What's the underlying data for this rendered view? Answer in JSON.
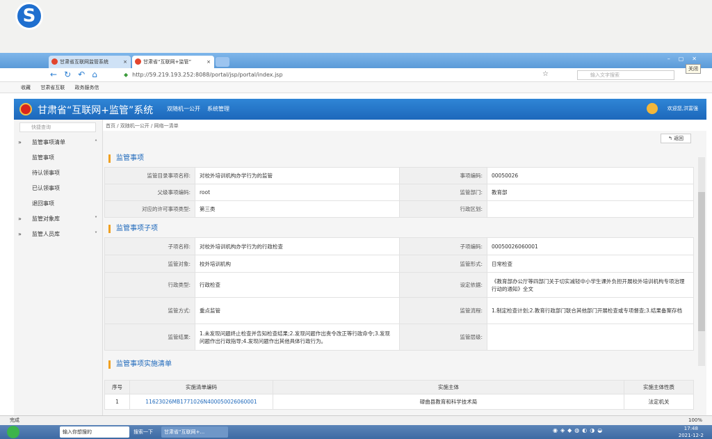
{
  "browser": {
    "tab1": "甘肃省互联网监管系统",
    "tab2": "甘肃省“互联网+监管”",
    "url": "http://59.219.193.252:8088/portal/jsp/portal/index.jsp",
    "search_placeholder": "输入文字搜索",
    "close_tooltip": "关闭",
    "bookmarks": [
      "收藏",
      "甘肃省互联",
      "政务服务信"
    ]
  },
  "app": {
    "title": "甘肃省“互联网+监管”系统",
    "menu": [
      "双随机一公开",
      "系统管理"
    ],
    "welcome": "欢迎您,洪富强"
  },
  "sidebar": {
    "search_placeholder": "快捷查询",
    "group1": "监管事项清单",
    "items": [
      "监管事项",
      "待认领事项",
      "已认领事项",
      "退回事项"
    ],
    "group2": "监管对象库",
    "group3": "监管人员库"
  },
  "breadcrumb": "首页 / 双随机一公开 / 网络一清单",
  "back_label": "返回",
  "section1": {
    "title": "监管事项",
    "rows": [
      [
        "监管目录事项名称:",
        "对校外培训机构办学行为的监管",
        "事项编码:",
        "00050026"
      ],
      [
        "父级事项编码:",
        "root",
        "监管部门:",
        "教育部"
      ],
      [
        "对应的许可事项类型:",
        "第三类",
        "行政区划:",
        ""
      ]
    ]
  },
  "section2": {
    "title": "监管事项子项",
    "rows": [
      [
        "子项名称:",
        "对校外培训机构办学行为的行政检查",
        "子项编码:",
        "00050026060001"
      ],
      [
        "监管对象:",
        "校外培训机构",
        "监管形式:",
        "日常检查"
      ],
      [
        "行政类型:",
        "行政检查",
        "设定依据:",
        "《教育部办公厅等四部门关于切实减轻中小学生课外负担开展校外培训机构专项治理行动的通知》全文"
      ],
      [
        "监管方式:",
        "重点监管",
        "监管流程:",
        "1.制定检查计划;2.教育行政部门联合其他部门开展检查或专项督查;3.结果备案存档"
      ],
      [
        "监管结果:",
        "1.未发现问题终止检查并告知检查结果;2.发现问题作出责令改正等行政命令;3.发现问题作出行政指导;4.发现问题作出其他具体行政行为。",
        "监管层级:",
        ""
      ]
    ]
  },
  "section3": {
    "title": "监管事项实施清单",
    "headers": [
      "序号",
      "实施清单编码",
      "实施主体",
      "实施主体性质"
    ],
    "rows": [
      [
        "1",
        "11623026MB1771026N400050026060001",
        "碌曲县教育和科学技术局",
        "法定机关"
      ]
    ]
  },
  "statusbar": {
    "text": "完成",
    "zoom": "100%"
  },
  "taskbar": {
    "item1": "输入你想搜的",
    "item2": "搜索一下",
    "item3": "甘肃省“互联网+...",
    "time": "17:48",
    "date": "2021-12-2"
  }
}
